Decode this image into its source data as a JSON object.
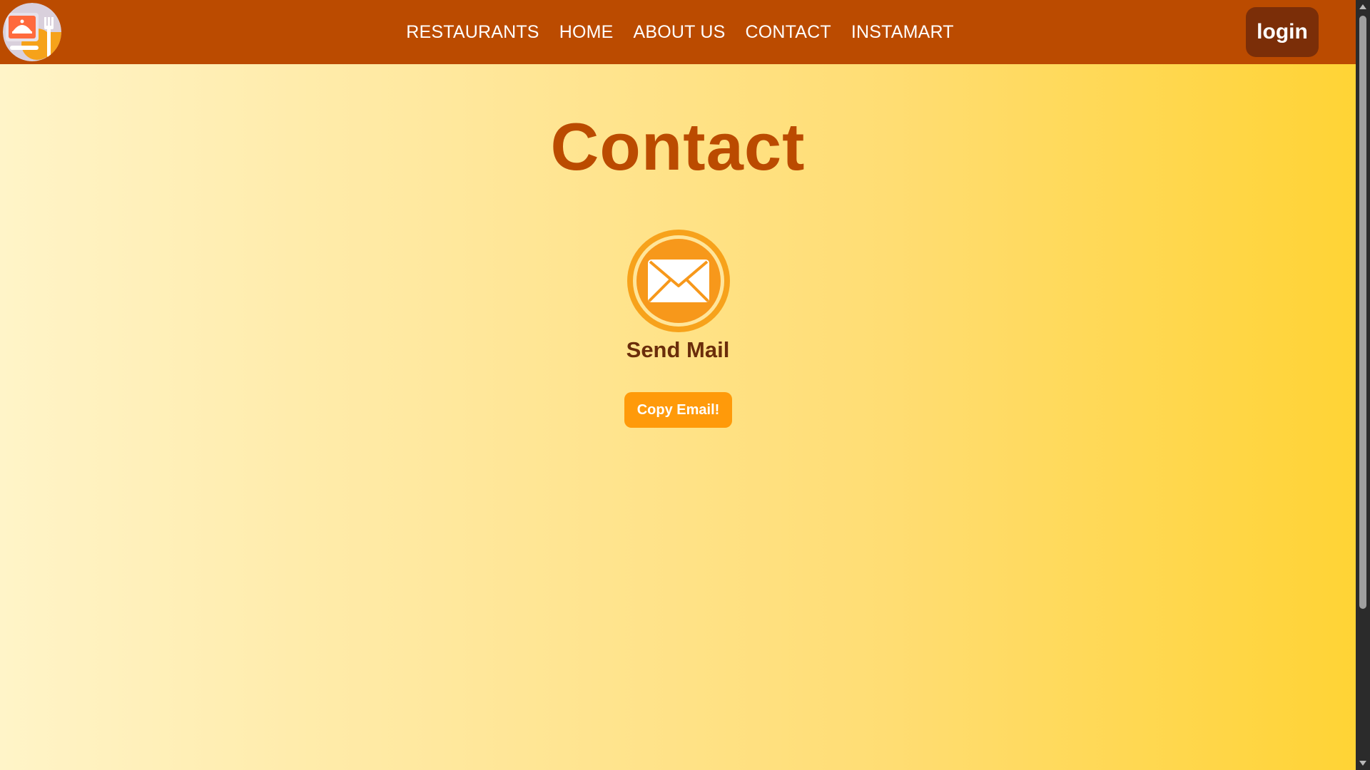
{
  "header": {
    "logo_icon": "food-delivery-logo-icon",
    "nav": [
      {
        "label": "RESTAURANTS"
      },
      {
        "label": "HOME"
      },
      {
        "label": "ABOUT US"
      },
      {
        "label": "CONTACT"
      },
      {
        "label": "INSTAMART"
      }
    ],
    "login_label": "login",
    "background_color": "#bb4b00"
  },
  "main": {
    "title": "Contact",
    "mail_icon": "envelope-icon",
    "send_label": "Send Mail",
    "copy_button_label": "Copy Email!"
  },
  "colors": {
    "brand": "#bb4b00",
    "accent": "#ff9a0a",
    "login_bg": "#7b2e08"
  }
}
